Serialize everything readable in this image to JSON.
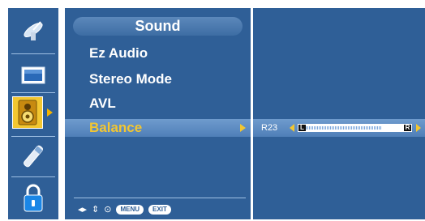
{
  "icons": [
    {
      "name": "picture-satellite-icon",
      "selected": false
    },
    {
      "name": "screen-icon",
      "selected": false
    },
    {
      "name": "sound-speaker-icon",
      "selected": true
    },
    {
      "name": "option-pen-icon",
      "selected": false
    },
    {
      "name": "lock-icon",
      "selected": false
    }
  ],
  "menu": {
    "title": "Sound",
    "items": [
      {
        "label": "Ez Audio"
      },
      {
        "label": "Stereo Mode"
      },
      {
        "label": "AVL"
      },
      {
        "label": "Balance",
        "selected": true
      }
    ]
  },
  "footer": {
    "nav_icons": [
      "left-right-arrows-icon",
      "up-down-arrows-icon",
      "select-circle-icon"
    ],
    "menu_label": "MENU",
    "exit_label": "EXIT"
  },
  "balance": {
    "value_text": "R23",
    "left_label": "L",
    "right_label": "R",
    "level_fraction": 0.77
  },
  "colors": {
    "panel": "#2f5f97",
    "highlight_text": "#f2c631",
    "selected_row": "#5f8ec6"
  }
}
